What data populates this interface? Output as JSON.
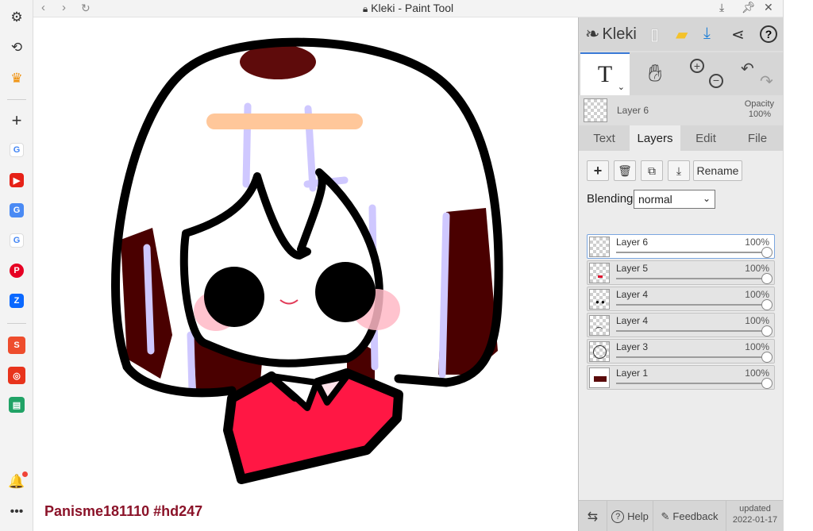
{
  "browser": {
    "window_title": "Kleki - Paint Tool",
    "sidebar_items": [
      "settings-icon",
      "history-icon",
      "crown-icon",
      "add-icon",
      "google",
      "youtube",
      "translate",
      "google",
      "pinterest",
      "zalo",
      "shopee",
      "game",
      "sheets"
    ]
  },
  "app": {
    "brand": "Kleki"
  },
  "layer_header": {
    "name": "Layer 6",
    "opacity_label": "Opacity",
    "opacity_value": "100%"
  },
  "tabs": [
    {
      "label": "Text"
    },
    {
      "label": "Layers"
    },
    {
      "label": "Edit"
    },
    {
      "label": "File"
    }
  ],
  "layer_tools": {
    "rename_label": "Rename"
  },
  "blending": {
    "label": "Blending",
    "value": "normal"
  },
  "layers": [
    {
      "name": "Layer 6",
      "opacity": "100%",
      "selected": true,
      "opacity_fraction": 1.0
    },
    {
      "name": "Layer 5",
      "opacity": "100%",
      "selected": false,
      "opacity_fraction": 1.0
    },
    {
      "name": "Layer 4",
      "opacity": "100%",
      "selected": false,
      "opacity_fraction": 1.0
    },
    {
      "name": "Layer 4",
      "opacity": "100%",
      "selected": false,
      "opacity_fraction": 1.0
    },
    {
      "name": "Layer 3",
      "opacity": "100%",
      "selected": false,
      "opacity_fraction": 1.0
    },
    {
      "name": "Layer 1",
      "opacity": "100%",
      "selected": false,
      "opacity_fraction": 1.0
    }
  ],
  "footer": {
    "help_label": "Help",
    "feedback_label": "Feedback",
    "updated_label": "updated",
    "updated_date": "2022-01-17"
  },
  "canvas": {
    "watermark": "Panisme181110 #hd247"
  },
  "colors": {
    "accent": "#3b7ad6",
    "download": "#1f7fd6",
    "watermark": "#8b1329"
  }
}
